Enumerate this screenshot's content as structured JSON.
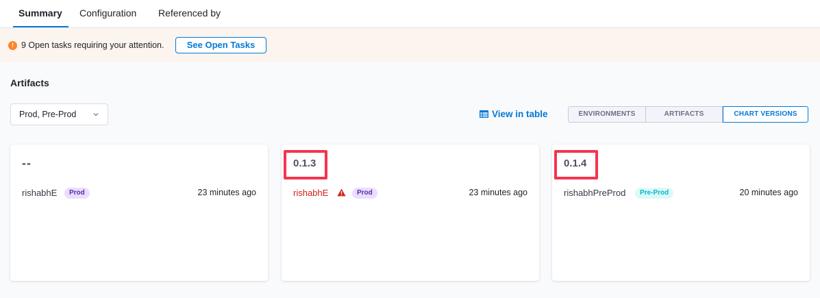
{
  "tabs": [
    {
      "label": "Summary",
      "active": true
    },
    {
      "label": "Configuration",
      "active": false
    },
    {
      "label": "Referenced by",
      "active": false
    }
  ],
  "banner": {
    "icon": "alert-dot-icon",
    "icon_glyph": "!",
    "message": "9 Open tasks requiring your attention.",
    "button_label": "See Open Tasks",
    "background": "#fcf4ef",
    "accent": "#ff832b"
  },
  "artifacts": {
    "title": "Artifacts",
    "env_filter": {
      "selected": "Prod, Pre-Prod",
      "icon": "chevron-down-icon"
    },
    "view_in_table": {
      "label": "View in table",
      "icon": "table-icon"
    },
    "view_toggle": {
      "options": [
        "ENVIRONMENTS",
        "ARTIFACTS",
        "CHART VERSIONS"
      ],
      "selected": "CHART VERSIONS"
    }
  },
  "cards": [
    {
      "version": "--",
      "infra": "rishabhE",
      "status": "ok",
      "env": "Prod",
      "env_type": "prod",
      "time": "23 minutes ago",
      "highlighted": false
    },
    {
      "version": "0.1.3",
      "infra": "rishabhE",
      "status": "error",
      "env": "Prod",
      "env_type": "prod",
      "time": "23 minutes ago",
      "highlighted": true
    },
    {
      "version": "0.1.4",
      "infra": "rishabhPreProd",
      "status": "ok",
      "env": "Pre-Prod",
      "env_type": "preprod",
      "time": "20 minutes ago",
      "highlighted": true
    }
  ],
  "colors": {
    "accent": "#0278d5",
    "highlight": "#f5334f",
    "error": "#cf2318",
    "prod_badge": "#eadeff",
    "preprod_badge": "#dcf9f9"
  }
}
